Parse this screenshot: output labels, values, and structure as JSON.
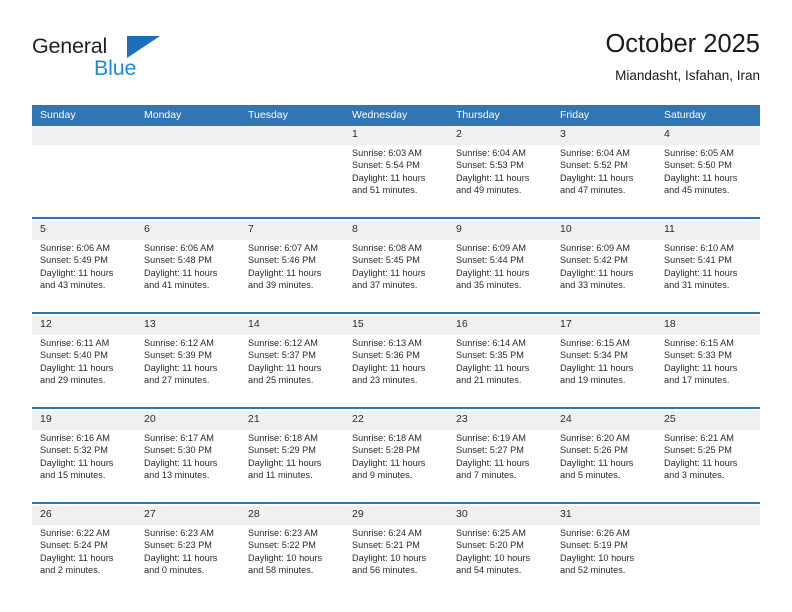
{
  "brand": {
    "name_top": "General",
    "name_bottom": "Blue",
    "accent_color": "#1b8ad8",
    "triangle_color": "#1b70b8"
  },
  "header": {
    "title": "October 2025",
    "subtitle": "Miandasht, Isfahan, Iran"
  },
  "theme": {
    "header_blue": "#3175b4",
    "daynum_band": "#f0f0f0",
    "text": "#2b2b2b"
  },
  "weekdays": [
    "Sunday",
    "Monday",
    "Tuesday",
    "Wednesday",
    "Thursday",
    "Friday",
    "Saturday"
  ],
  "weeks": [
    [
      {
        "day": "",
        "sunrise": "",
        "sunset": "",
        "daylight1": "",
        "daylight2": ""
      },
      {
        "day": "",
        "sunrise": "",
        "sunset": "",
        "daylight1": "",
        "daylight2": ""
      },
      {
        "day": "",
        "sunrise": "",
        "sunset": "",
        "daylight1": "",
        "daylight2": ""
      },
      {
        "day": "1",
        "sunrise": "Sunrise: 6:03 AM",
        "sunset": "Sunset: 5:54 PM",
        "daylight1": "Daylight: 11 hours",
        "daylight2": "and 51 minutes."
      },
      {
        "day": "2",
        "sunrise": "Sunrise: 6:04 AM",
        "sunset": "Sunset: 5:53 PM",
        "daylight1": "Daylight: 11 hours",
        "daylight2": "and 49 minutes."
      },
      {
        "day": "3",
        "sunrise": "Sunrise: 6:04 AM",
        "sunset": "Sunset: 5:52 PM",
        "daylight1": "Daylight: 11 hours",
        "daylight2": "and 47 minutes."
      },
      {
        "day": "4",
        "sunrise": "Sunrise: 6:05 AM",
        "sunset": "Sunset: 5:50 PM",
        "daylight1": "Daylight: 11 hours",
        "daylight2": "and 45 minutes."
      }
    ],
    [
      {
        "day": "5",
        "sunrise": "Sunrise: 6:06 AM",
        "sunset": "Sunset: 5:49 PM",
        "daylight1": "Daylight: 11 hours",
        "daylight2": "and 43 minutes."
      },
      {
        "day": "6",
        "sunrise": "Sunrise: 6:06 AM",
        "sunset": "Sunset: 5:48 PM",
        "daylight1": "Daylight: 11 hours",
        "daylight2": "and 41 minutes."
      },
      {
        "day": "7",
        "sunrise": "Sunrise: 6:07 AM",
        "sunset": "Sunset: 5:46 PM",
        "daylight1": "Daylight: 11 hours",
        "daylight2": "and 39 minutes."
      },
      {
        "day": "8",
        "sunrise": "Sunrise: 6:08 AM",
        "sunset": "Sunset: 5:45 PM",
        "daylight1": "Daylight: 11 hours",
        "daylight2": "and 37 minutes."
      },
      {
        "day": "9",
        "sunrise": "Sunrise: 6:09 AM",
        "sunset": "Sunset: 5:44 PM",
        "daylight1": "Daylight: 11 hours",
        "daylight2": "and 35 minutes."
      },
      {
        "day": "10",
        "sunrise": "Sunrise: 6:09 AM",
        "sunset": "Sunset: 5:42 PM",
        "daylight1": "Daylight: 11 hours",
        "daylight2": "and 33 minutes."
      },
      {
        "day": "11",
        "sunrise": "Sunrise: 6:10 AM",
        "sunset": "Sunset: 5:41 PM",
        "daylight1": "Daylight: 11 hours",
        "daylight2": "and 31 minutes."
      }
    ],
    [
      {
        "day": "12",
        "sunrise": "Sunrise: 6:11 AM",
        "sunset": "Sunset: 5:40 PM",
        "daylight1": "Daylight: 11 hours",
        "daylight2": "and 29 minutes."
      },
      {
        "day": "13",
        "sunrise": "Sunrise: 6:12 AM",
        "sunset": "Sunset: 5:39 PM",
        "daylight1": "Daylight: 11 hours",
        "daylight2": "and 27 minutes."
      },
      {
        "day": "14",
        "sunrise": "Sunrise: 6:12 AM",
        "sunset": "Sunset: 5:37 PM",
        "daylight1": "Daylight: 11 hours",
        "daylight2": "and 25 minutes."
      },
      {
        "day": "15",
        "sunrise": "Sunrise: 6:13 AM",
        "sunset": "Sunset: 5:36 PM",
        "daylight1": "Daylight: 11 hours",
        "daylight2": "and 23 minutes."
      },
      {
        "day": "16",
        "sunrise": "Sunrise: 6:14 AM",
        "sunset": "Sunset: 5:35 PM",
        "daylight1": "Daylight: 11 hours",
        "daylight2": "and 21 minutes."
      },
      {
        "day": "17",
        "sunrise": "Sunrise: 6:15 AM",
        "sunset": "Sunset: 5:34 PM",
        "daylight1": "Daylight: 11 hours",
        "daylight2": "and 19 minutes."
      },
      {
        "day": "18",
        "sunrise": "Sunrise: 6:15 AM",
        "sunset": "Sunset: 5:33 PM",
        "daylight1": "Daylight: 11 hours",
        "daylight2": "and 17 minutes."
      }
    ],
    [
      {
        "day": "19",
        "sunrise": "Sunrise: 6:16 AM",
        "sunset": "Sunset: 5:32 PM",
        "daylight1": "Daylight: 11 hours",
        "daylight2": "and 15 minutes."
      },
      {
        "day": "20",
        "sunrise": "Sunrise: 6:17 AM",
        "sunset": "Sunset: 5:30 PM",
        "daylight1": "Daylight: 11 hours",
        "daylight2": "and 13 minutes."
      },
      {
        "day": "21",
        "sunrise": "Sunrise: 6:18 AM",
        "sunset": "Sunset: 5:29 PM",
        "daylight1": "Daylight: 11 hours",
        "daylight2": "and 11 minutes."
      },
      {
        "day": "22",
        "sunrise": "Sunrise: 6:18 AM",
        "sunset": "Sunset: 5:28 PM",
        "daylight1": "Daylight: 11 hours",
        "daylight2": "and 9 minutes."
      },
      {
        "day": "23",
        "sunrise": "Sunrise: 6:19 AM",
        "sunset": "Sunset: 5:27 PM",
        "daylight1": "Daylight: 11 hours",
        "daylight2": "and 7 minutes."
      },
      {
        "day": "24",
        "sunrise": "Sunrise: 6:20 AM",
        "sunset": "Sunset: 5:26 PM",
        "daylight1": "Daylight: 11 hours",
        "daylight2": "and 5 minutes."
      },
      {
        "day": "25",
        "sunrise": "Sunrise: 6:21 AM",
        "sunset": "Sunset: 5:25 PM",
        "daylight1": "Daylight: 11 hours",
        "daylight2": "and 3 minutes."
      }
    ],
    [
      {
        "day": "26",
        "sunrise": "Sunrise: 6:22 AM",
        "sunset": "Sunset: 5:24 PM",
        "daylight1": "Daylight: 11 hours",
        "daylight2": "and 2 minutes."
      },
      {
        "day": "27",
        "sunrise": "Sunrise: 6:23 AM",
        "sunset": "Sunset: 5:23 PM",
        "daylight1": "Daylight: 11 hours",
        "daylight2": "and 0 minutes."
      },
      {
        "day": "28",
        "sunrise": "Sunrise: 6:23 AM",
        "sunset": "Sunset: 5:22 PM",
        "daylight1": "Daylight: 10 hours",
        "daylight2": "and 58 minutes."
      },
      {
        "day": "29",
        "sunrise": "Sunrise: 6:24 AM",
        "sunset": "Sunset: 5:21 PM",
        "daylight1": "Daylight: 10 hours",
        "daylight2": "and 56 minutes."
      },
      {
        "day": "30",
        "sunrise": "Sunrise: 6:25 AM",
        "sunset": "Sunset: 5:20 PM",
        "daylight1": "Daylight: 10 hours",
        "daylight2": "and 54 minutes."
      },
      {
        "day": "31",
        "sunrise": "Sunrise: 6:26 AM",
        "sunset": "Sunset: 5:19 PM",
        "daylight1": "Daylight: 10 hours",
        "daylight2": "and 52 minutes."
      },
      {
        "day": "",
        "sunrise": "",
        "sunset": "",
        "daylight1": "",
        "daylight2": ""
      }
    ]
  ]
}
